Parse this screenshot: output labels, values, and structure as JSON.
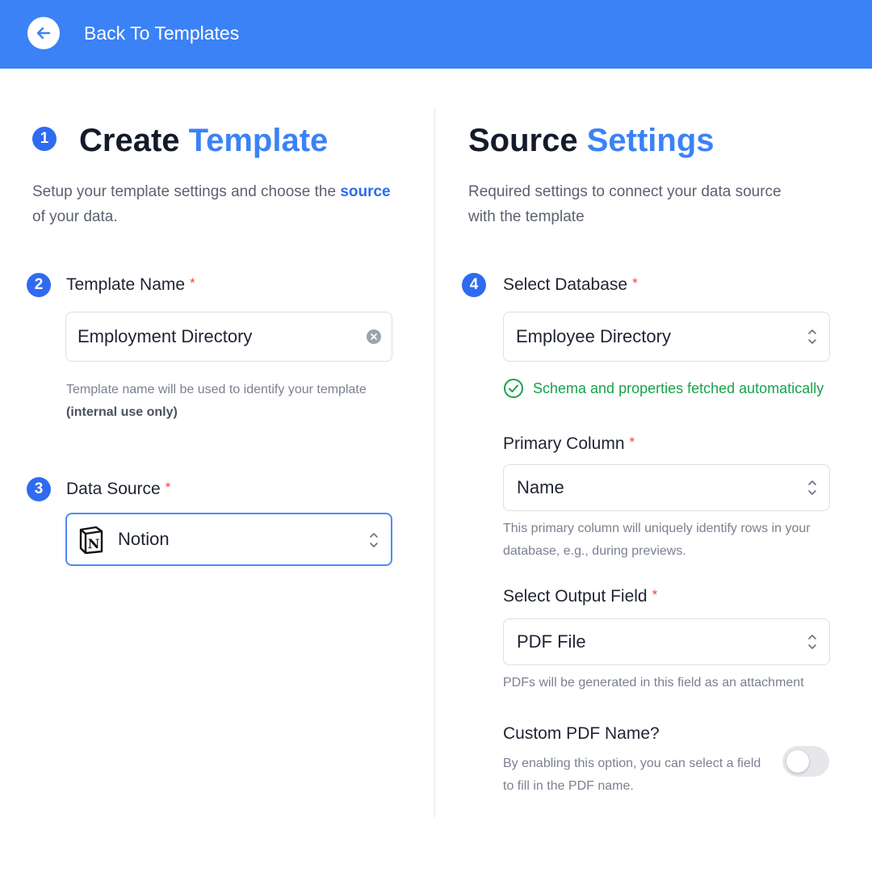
{
  "header": {
    "back_label": "Back To Templates"
  },
  "left": {
    "step1": "1",
    "title_part1": "Create",
    "title_part2": "Template",
    "desc_part1": "Setup your template settings and choose the ",
    "desc_source": "source",
    "desc_part2": "of your data.",
    "template_name": {
      "step": "2",
      "label": "Template Name",
      "required": "*",
      "value": "Employment Directory",
      "help_line1": "Template name will be used to identify your template",
      "help_line2": "(internal use only)"
    },
    "data_source": {
      "step": "3",
      "label": "Data Source",
      "required": "*",
      "value": "Notion",
      "logo_letter": "N"
    }
  },
  "right": {
    "title_part1": "Source",
    "title_part2": "Settings",
    "desc_line1": "Required settings to connect your data source",
    "desc_line2": "with the template",
    "database": {
      "step": "4",
      "label": "Select Database",
      "required": "*",
      "value": "Employee Directory",
      "status": "Schema and properties fetched automatically"
    },
    "primary_column": {
      "label": "Primary Column",
      "required": "*",
      "value": "Name",
      "help_line1": "This primary column will uniquely identify rows in your",
      "help_line2": "database, e.g., during previews."
    },
    "output_field": {
      "label": "Select Output Field",
      "required": "*",
      "value": "PDF File",
      "help": "PDFs will be generated in this field as an attachment"
    },
    "custom_pdf": {
      "label": "Custom PDF Name?",
      "help_line1": "By enabling this option, you can select a field",
      "help_line2": "to fill in the PDF name.",
      "enabled": false
    }
  },
  "colors": {
    "brand": "#3b82f6",
    "step_badge": "#2f6bf0",
    "required": "#ef4444",
    "success": "#16a34a"
  }
}
